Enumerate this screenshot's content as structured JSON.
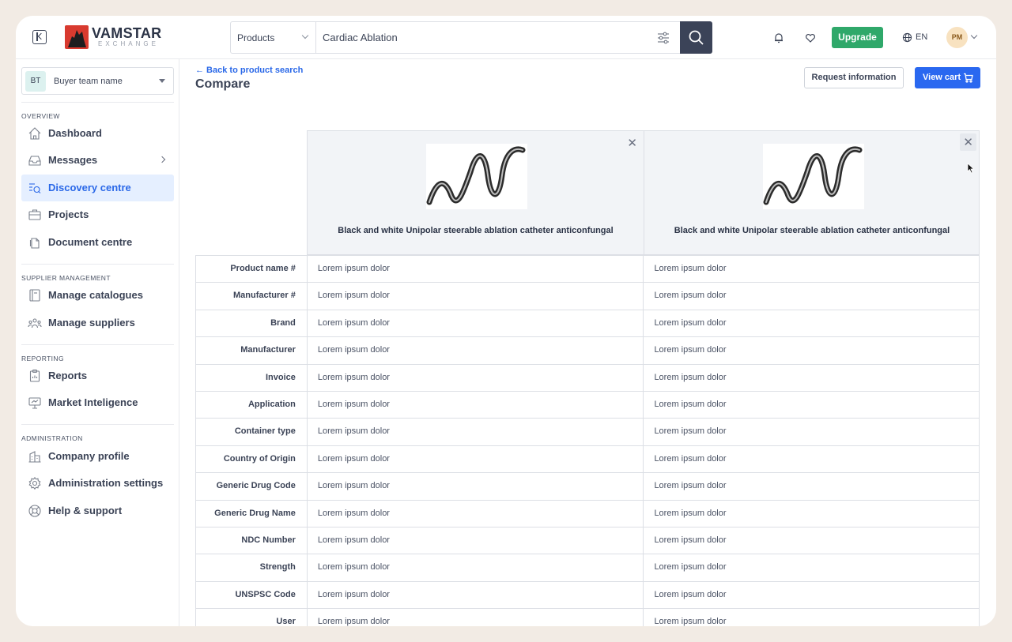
{
  "header": {
    "logo_name": "VAMSTAR",
    "logo_sub": "EXCHANGE",
    "search_category": "Products",
    "search_value": "Cardiac Ablation",
    "upgrade_label": "Upgrade",
    "language": "EN",
    "user_initials": "PM"
  },
  "sidebar": {
    "team_initials": "BT",
    "team_name": "Buyer team name",
    "sections": {
      "overview": "OVERVIEW",
      "supplier": "SUPPLIER MANAGEMENT",
      "reporting": "REPORTING",
      "administration": "ADMINISTRATION"
    },
    "items": [
      {
        "label": "Dashboard",
        "icon": "home-icon"
      },
      {
        "label": "Messages",
        "icon": "inbox-icon"
      },
      {
        "label": "Discovery centre",
        "icon": "discovery-icon",
        "active": true
      },
      {
        "label": "Projects",
        "icon": "briefcase-icon"
      },
      {
        "label": "Document centre",
        "icon": "documents-icon"
      },
      {
        "label": "Manage catalogues",
        "icon": "catalogue-icon"
      },
      {
        "label": "Manage suppliers",
        "icon": "suppliers-icon"
      },
      {
        "label": "Reports",
        "icon": "clipboard-icon"
      },
      {
        "label": "Market Inteligence",
        "icon": "presentation-icon"
      },
      {
        "label": "Company profile",
        "icon": "building-icon"
      },
      {
        "label": "Administration settings",
        "icon": "gear-icon"
      },
      {
        "label": "Help & support",
        "icon": "lifebuoy-icon"
      }
    ]
  },
  "page": {
    "back_link": "← Back to product search",
    "title": "Compare",
    "request_info_label": "Request information",
    "view_cart_label": "View cart"
  },
  "products": [
    {
      "name": "Black and white Unipolar steerable ablation catheter anticonfungal"
    },
    {
      "name": "Black and white Unipolar steerable ablation catheter anticonfungal"
    }
  ],
  "comparison": {
    "rows": [
      {
        "label": "Product name #",
        "values": [
          "Lorem ipsum dolor",
          "Lorem ipsum dolor"
        ]
      },
      {
        "label": "Manufacturer #",
        "values": [
          "Lorem ipsum dolor",
          "Lorem ipsum dolor"
        ]
      },
      {
        "label": "Brand",
        "values": [
          "Lorem ipsum dolor",
          "Lorem ipsum dolor"
        ]
      },
      {
        "label": "Manufacturer",
        "values": [
          "Lorem ipsum dolor",
          "Lorem ipsum dolor"
        ]
      },
      {
        "label": "Invoice",
        "values": [
          "Lorem ipsum dolor",
          "Lorem ipsum dolor"
        ]
      },
      {
        "label": "Application",
        "values": [
          "Lorem ipsum dolor",
          "Lorem ipsum dolor"
        ]
      },
      {
        "label": "Container type",
        "values": [
          "Lorem ipsum dolor",
          "Lorem ipsum dolor"
        ]
      },
      {
        "label": "Country of Origin",
        "values": [
          "Lorem ipsum dolor",
          "Lorem ipsum dolor"
        ]
      },
      {
        "label": "Generic Drug Code",
        "values": [
          "Lorem ipsum dolor",
          "Lorem ipsum dolor"
        ]
      },
      {
        "label": "Generic Drug Name",
        "values": [
          "Lorem ipsum dolor",
          "Lorem ipsum dolor"
        ]
      },
      {
        "label": "NDC Number",
        "values": [
          "Lorem ipsum dolor",
          "Lorem ipsum dolor"
        ]
      },
      {
        "label": "Strength",
        "values": [
          "Lorem ipsum dolor",
          "Lorem ipsum dolor"
        ]
      },
      {
        "label": "UNSPSC Code",
        "values": [
          "Lorem ipsum dolor",
          "Lorem ipsum dolor"
        ]
      },
      {
        "label": "User",
        "values": [
          "Lorem ipsum dolor",
          "Lorem ipsum dolor"
        ]
      }
    ]
  },
  "colors": {
    "accent": "#2a68f0",
    "upgrade": "#2fa86a",
    "active_nav_bg": "#e5efff",
    "search_button": "#3b4358"
  }
}
